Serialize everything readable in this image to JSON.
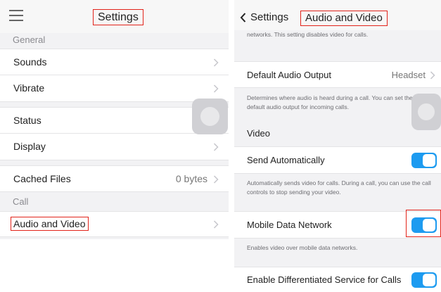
{
  "left": {
    "title": "Settings",
    "sections": {
      "general": "General",
      "call": "Call"
    },
    "items": {
      "sounds": "Sounds",
      "vibrate": "Vibrate",
      "status": "Status",
      "display": "Display",
      "cached_files": "Cached Files",
      "cached_files_value": "0 bytes",
      "audio_video": "Audio and Video"
    }
  },
  "right": {
    "back_label": "Settings",
    "title": "Audio and Video",
    "top_help": "networks. This setting disables video for calls.",
    "default_audio_output": "Default Audio Output",
    "default_audio_output_value": "Headset",
    "audio_help": "Determines where audio is heard during a call. You can set the default audio output for incoming calls.",
    "video_header": "Video",
    "send_automatically": "Send Automatically",
    "send_help": "Automatically sends video for calls. During a call, you can use the call controls to stop sending your video.",
    "mobile_data_network": "Mobile Data Network",
    "mobile_help": "Enables video over mobile data networks.",
    "enable_diff_service": "Enable Differentiated Service for Calls"
  },
  "toggles": {
    "send_automatically": true,
    "mobile_data_network": true,
    "enable_diff_service": true
  },
  "colors": {
    "toggle_on": "#1d9bf0",
    "highlight": "#e2231a"
  },
  "icons": [
    "hamburger-menu-icon",
    "chevron-right-icon",
    "back-chevron-icon",
    "assistive-touch-icon"
  ]
}
